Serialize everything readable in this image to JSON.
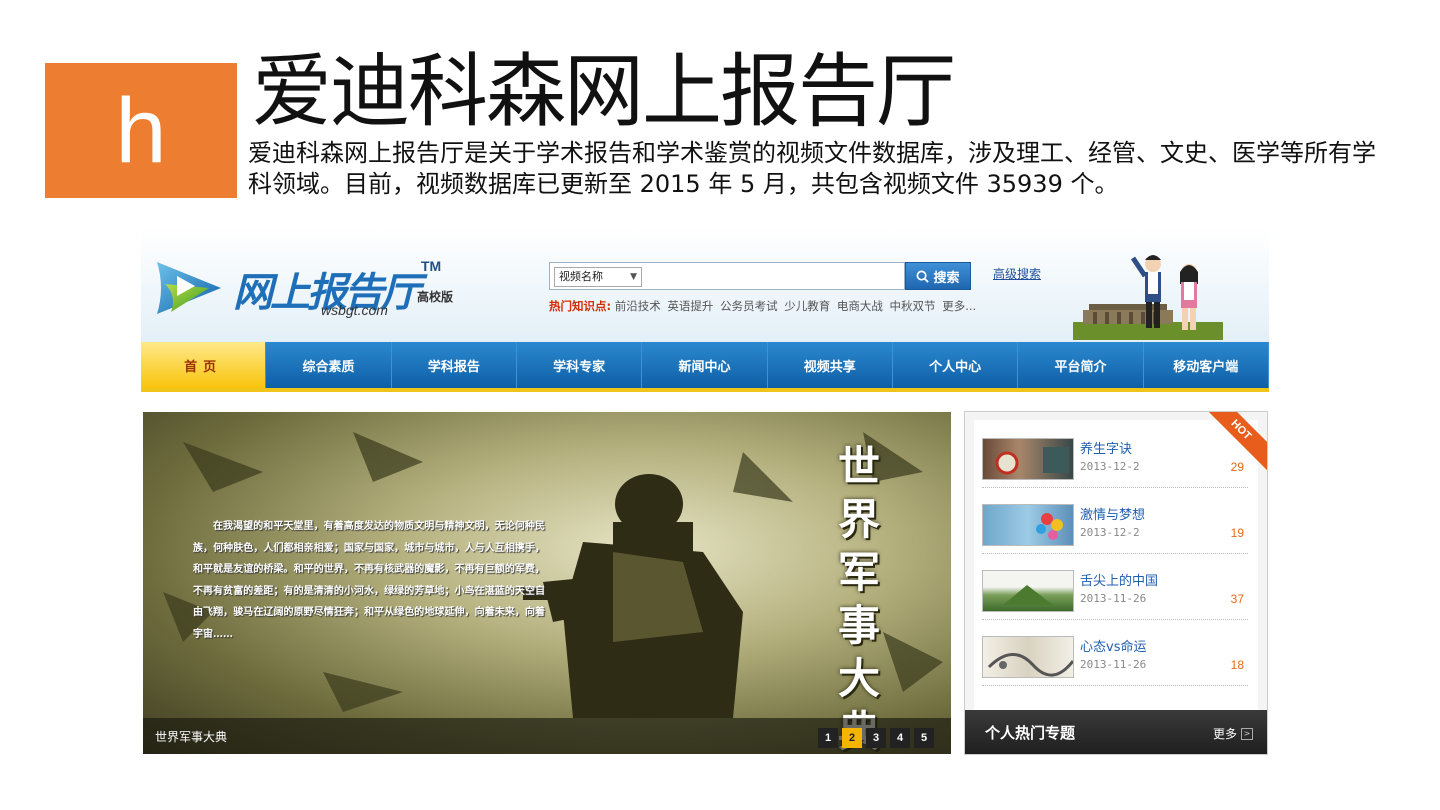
{
  "slide": {
    "badge_letter": "h",
    "title": "爱迪科森网上报告厅",
    "description": "爱迪科森网上报告厅是关于学术报告和学术鉴赏的视频文件数据库，涉及理工、经管、文史、医学等所有学科领域。目前，视频数据库已更新至 2015 年 5 月，共包含视频文件 35939 个。"
  },
  "site": {
    "logo": {
      "text": "网上报告厅",
      "tm": "TM",
      "edition": "高校版",
      "domain": "wsbgt.com"
    },
    "search": {
      "select_value": "视频名称",
      "input_value": "",
      "button_label": "搜索",
      "advanced_label": "高级搜索"
    },
    "hot_keywords": {
      "label": "热门知识点:",
      "items": [
        "前沿技术",
        "英语提升",
        "公务员考试",
        "少儿教育",
        "电商大战",
        "中秋双节",
        "更多..."
      ]
    },
    "nav": [
      "首页",
      "综合素质",
      "学科报告",
      "学科专家",
      "新闻中心",
      "视频共享",
      "个人中心",
      "平台简介",
      "移动客户端"
    ],
    "banner": {
      "text": "在我渴望的和平天堂里，有着高度发达的物质文明与精神文明，无论何种民族，何种肤色，人们都相亲相爱；国家与国家，城市与城市，人与人互相携手，和平就是友谊的桥梁。和平的世界，不再有核武器的魔影，不再有巨额的军费，不再有贫富的差距；有的是清清的小河水，绿绿的芳草地；小鸟在湛蓝的天空自由飞翔，骏马在辽阔的原野尽情狂奔；和平从绿色的地球延伸，向着未来，向着宇宙……",
      "vertical_title": [
        "世",
        "界",
        "军",
        "事",
        "大",
        "典"
      ],
      "caption": "世界军事大典",
      "pages": [
        "1",
        "2",
        "3",
        "4",
        "5"
      ],
      "active_page": "2"
    },
    "hot_panel": {
      "ribbon": "HOT",
      "items": [
        {
          "title": "养生字诀",
          "date": "2013-12-2",
          "count": "29"
        },
        {
          "title": "激情与梦想",
          "date": "2013-12-2",
          "count": "19"
        },
        {
          "title": "舌尖上的中国",
          "date": "2013-11-26",
          "count": "37"
        },
        {
          "title": "心态vs命运",
          "date": "2013-11-26",
          "count": "18"
        }
      ],
      "footer_title": "个人热门专题",
      "footer_more": "更多"
    },
    "colors": {
      "badge": "#ed7d31",
      "nav": "#1a6fb8",
      "nav_active": "#f8c40c",
      "accent_orange": "#e46a17"
    }
  }
}
